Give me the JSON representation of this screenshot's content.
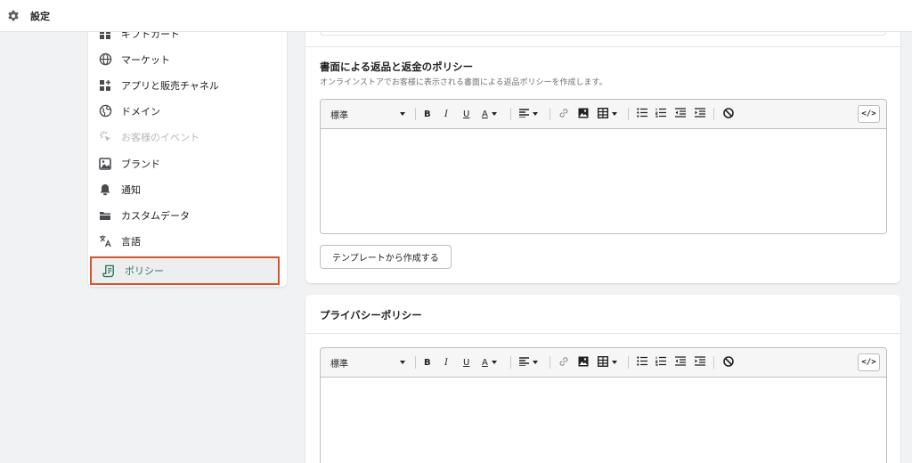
{
  "topbar": {
    "title": "設定",
    "icon": "gear-icon"
  },
  "sidebar": {
    "items": [
      {
        "label": "ギフトカード",
        "icon": "gift-card-icon",
        "state": "normal"
      },
      {
        "label": "マーケット",
        "icon": "globe-icon",
        "state": "normal"
      },
      {
        "label": "アプリと販売チャネル",
        "icon": "apps-icon",
        "state": "normal"
      },
      {
        "label": "ドメイン",
        "icon": "domain-globe-icon",
        "state": "normal"
      },
      {
        "label": "お客様のイベント",
        "icon": "cursor-click-icon",
        "state": "disabled"
      },
      {
        "label": "ブランド",
        "icon": "brand-icon",
        "state": "normal"
      },
      {
        "label": "通知",
        "icon": "bell-icon",
        "state": "normal"
      },
      {
        "label": "カスタムデータ",
        "icon": "folder-icon",
        "state": "normal"
      },
      {
        "label": "言語",
        "icon": "translate-icon",
        "state": "normal"
      },
      {
        "label": "ポリシー",
        "icon": "policy-scroll-icon",
        "state": "active"
      }
    ]
  },
  "refund_policy": {
    "title": "書面による返品と返金のポリシー",
    "subtitle": "オンラインストアでお客様に表示される書面による返品ポリシーを作成します。",
    "template_button": "テンプレートから作成する"
  },
  "privacy_policy": {
    "title": "プライバシーポリシー"
  },
  "toolbar": {
    "format_select": "標準",
    "bold": "B",
    "italic": "I",
    "underline": "U",
    "text_color": "A",
    "code_toggle": "</>"
  },
  "colors": {
    "accent_active_text": "#2e7a5c",
    "highlight_border": "#d9542c",
    "background": "#f1f2f4"
  }
}
